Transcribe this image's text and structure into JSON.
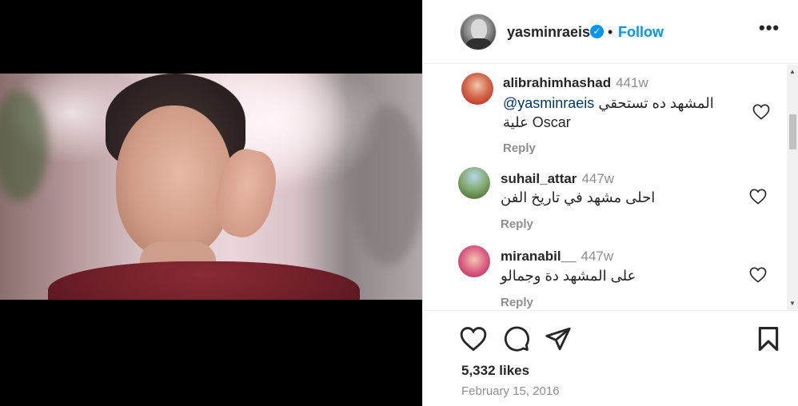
{
  "post": {
    "author": "yasminraeis",
    "follow_label": "Follow",
    "separator": "•",
    "more_label": "•••",
    "verified_mark": "✓"
  },
  "comments": [
    {
      "user": "alibrahimhashad",
      "time": "441w",
      "mention": "@yasminraeis",
      "text_line1": "المشهد ده تستحقي",
      "text_line2": "علية Oscar",
      "reply": "Reply"
    },
    {
      "user": "suhail_attar",
      "time": "447w",
      "text_line1": "احلى مشهد في تاريخ الفن",
      "reply": "Reply"
    },
    {
      "user": "miranabil__",
      "time": "447w",
      "text_line1": "على المشهد دة وجمالو",
      "reply": "Reply"
    }
  ],
  "stats": {
    "likes": "5,332 likes",
    "date": "February 15, 2016"
  },
  "icons": {
    "like": "heart-icon",
    "comment": "comment-bubble-icon",
    "share": "paper-plane-icon",
    "save": "bookmark-icon",
    "more": "ellipsis-icon",
    "verified": "verified-badge-icon"
  },
  "colors": {
    "accent": "#0095f6",
    "text": "#262626",
    "muted": "#8e8e8e",
    "mention": "#00376b"
  }
}
